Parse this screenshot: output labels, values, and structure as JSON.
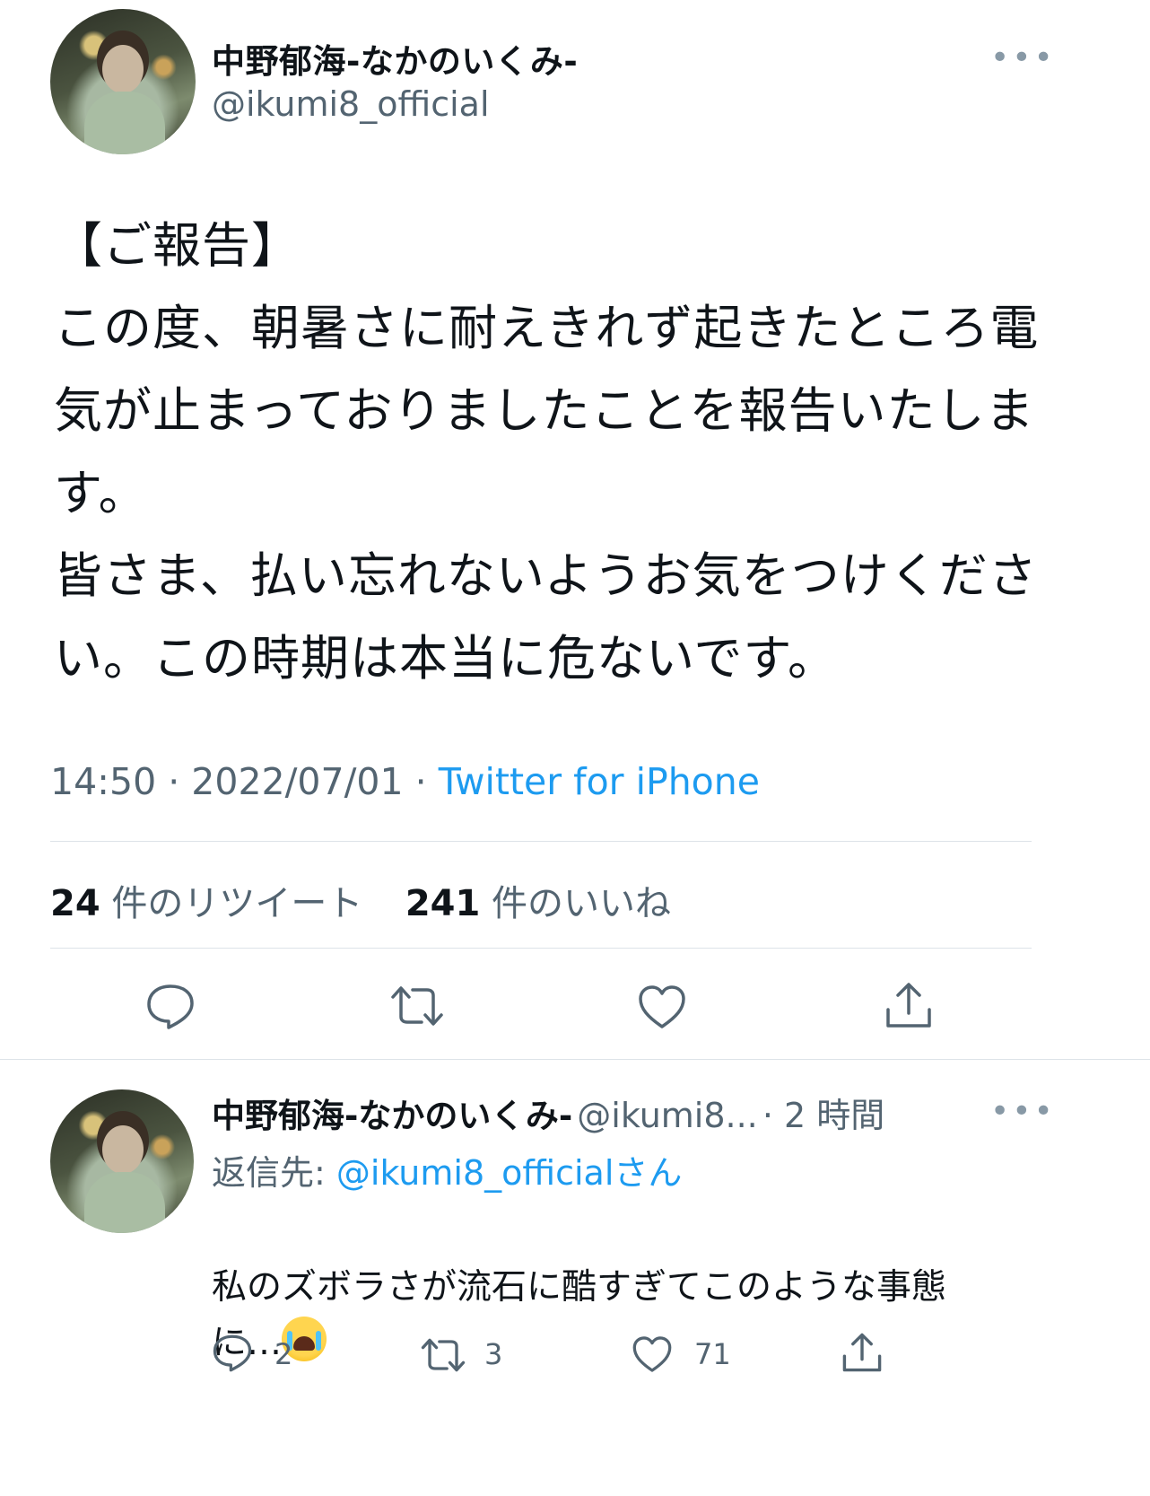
{
  "tweet": {
    "display_name": "中野郁海-なかのいくみ-",
    "handle": "@ikumi8_official",
    "more_label": "•••",
    "text": "【ご報告】\nこの度、朝暑さに耐えきれず起きたところ電気が止まっておりましたことを報告いたします。\n皆さま、払い忘れないようお気をつけください。この時期は本当に危ないです。",
    "time": "14:50",
    "date": "2022/07/01",
    "source": "Twitter for iPhone",
    "retweet_count": "24",
    "retweet_label": "件のリツイート",
    "like_count": "241",
    "like_label": "件のいいね"
  },
  "reply": {
    "display_name": "中野郁海-なかのいくみ-",
    "handle": "@ikumi8...",
    "time_ago": "2 時間",
    "more_label": "•••",
    "reply_to_prefix": "返信先: ",
    "reply_to_handle": "@ikumi8_official",
    "reply_to_suffix": "さん",
    "text": "私のズボラさが流石に酷すぎてこのような事態\nに…",
    "emoji": "loudly-crying-face",
    "reply_count": "2",
    "retweet_count": "3",
    "like_count": "71"
  },
  "colors": {
    "text": "#0f1419",
    "secondary": "#536471",
    "link": "#1d9bf0",
    "divider": "#dde3e8"
  },
  "icons": [
    "reply-icon",
    "retweet-icon",
    "like-icon",
    "share-icon",
    "more-icon"
  ]
}
